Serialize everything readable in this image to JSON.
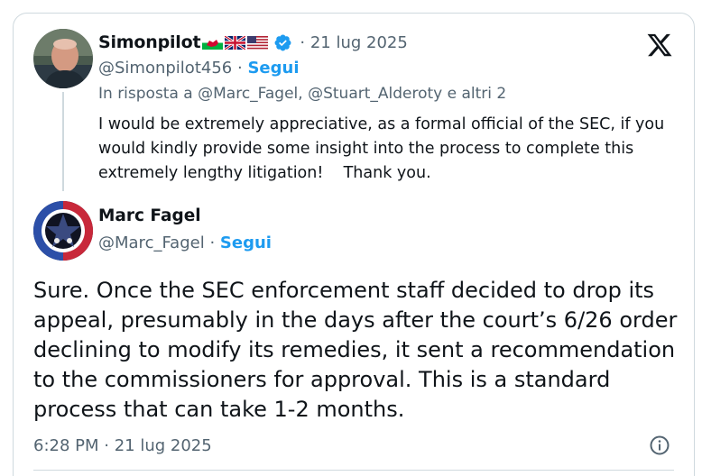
{
  "parent_tweet": {
    "display_name": "Simonpilot",
    "flag_icons": [
      "wales-flag-icon",
      "uk-flag-icon",
      "us-flag-icon"
    ],
    "verified_icon": "verified-badge-icon",
    "separator": "·",
    "date": "21 lug 2025",
    "handle": "@Simonpilot456",
    "follow_label": "Segui",
    "reply_to": "In risposta a @Marc_Fagel, @Stuart_Alderoty e altri 2",
    "text": "I would be extremely appreciative, as a formal official of the SEC, if you would kindly provide some insight into the process to complete this extremely lengthy litigation!    Thank you."
  },
  "main_tweet": {
    "display_name": "Marc Fagel",
    "handle": "@Marc_Fagel",
    "separator": "·",
    "follow_label": "Segui",
    "text": "Sure. Once the SEC enforcement staff decided to drop its appeal, presumably in the days after the court’s 6/26 order declining to modify its remedies, it sent a recommendation to the commissioners for approval. This is a standard process that can take 1-2 months.",
    "timestamp": "6:28 PM · 21 lug 2025",
    "info_icon": "info-icon"
  },
  "brand": {
    "logo_icon": "x-logo-icon",
    "follow_color": "#1d9bf0",
    "verified_color": "#1d9bf0",
    "text_color": "#0f1419",
    "muted_color": "#536471"
  }
}
